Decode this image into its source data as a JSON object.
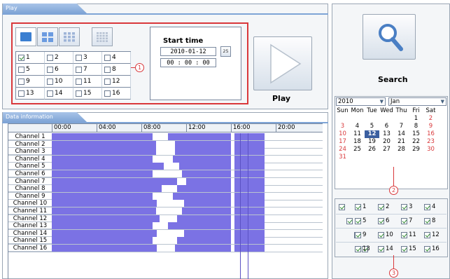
{
  "play_panel": {
    "tab_label": "Play",
    "callout_number": "1",
    "channels": [
      {
        "label": "1",
        "checked": true
      },
      {
        "label": "2",
        "checked": false
      },
      {
        "label": "3",
        "checked": false
      },
      {
        "label": "4",
        "checked": false
      },
      {
        "label": "5",
        "checked": false
      },
      {
        "label": "6",
        "checked": false
      },
      {
        "label": "7",
        "checked": false
      },
      {
        "label": "8",
        "checked": false
      },
      {
        "label": "9",
        "checked": false
      },
      {
        "label": "10",
        "checked": false
      },
      {
        "label": "11",
        "checked": false
      },
      {
        "label": "12",
        "checked": false
      },
      {
        "label": "13",
        "checked": false
      },
      {
        "label": "14",
        "checked": false
      },
      {
        "label": "15",
        "checked": false
      },
      {
        "label": "16",
        "checked": false
      }
    ],
    "layout_options": [
      "layout-1-icon",
      "layout-4-icon",
      "layout-9-icon",
      "layout-16-icon"
    ],
    "start_time_label": "Start time",
    "start_date": "2010-01-12",
    "start_time": "00 : 00 : 00",
    "calendar_button_label": "25",
    "play_button_label": "Play"
  },
  "data_panel": {
    "tab_label": "Data information",
    "time_ticks": [
      "00:00",
      "04:00",
      "08:00",
      "12:00",
      "16:00",
      "20:00"
    ],
    "channel_rows": [
      "Channel 1",
      "Channel 2",
      "Channel 3",
      "Channel 4",
      "Channel 5",
      "Channel 6",
      "Channel 7",
      "Channel 8",
      "Channel 9",
      "Channel 10",
      "Channel 11",
      "Channel 12",
      "Channel 13",
      "Channel 14",
      "Channel 15",
      "Channel 16"
    ],
    "bar_color": "#7b72e4"
  },
  "search_panel": {
    "search_label": "Search",
    "year_value": "2010",
    "month_value": "Jan",
    "weekdays": [
      "Sun",
      "Mon",
      "Tue",
      "Wed",
      "Thu",
      "Fri",
      "Sat"
    ],
    "weeks": [
      [
        "",
        "",
        "",
        "",
        "",
        "1",
        "2"
      ],
      [
        "3",
        "4",
        "5",
        "6",
        "7",
        "8",
        "9"
      ],
      [
        "10",
        "11",
        "12",
        "13",
        "14",
        "15",
        "16"
      ],
      [
        "17",
        "18",
        "19",
        "20",
        "21",
        "22",
        "23"
      ],
      [
        "24",
        "25",
        "26",
        "27",
        "28",
        "29",
        "30"
      ],
      [
        "31",
        "",
        "",
        "",
        "",
        "",
        ""
      ]
    ],
    "selected_day": "12",
    "callout_2": "2",
    "callout_3": "3",
    "channel_rows": [
      [
        "1",
        "2",
        "3",
        "4"
      ],
      [
        "5",
        "6",
        "7",
        "8"
      ],
      [
        "9",
        "10",
        "11",
        "12"
      ],
      [
        "13",
        "14",
        "15",
        "16"
      ]
    ]
  }
}
